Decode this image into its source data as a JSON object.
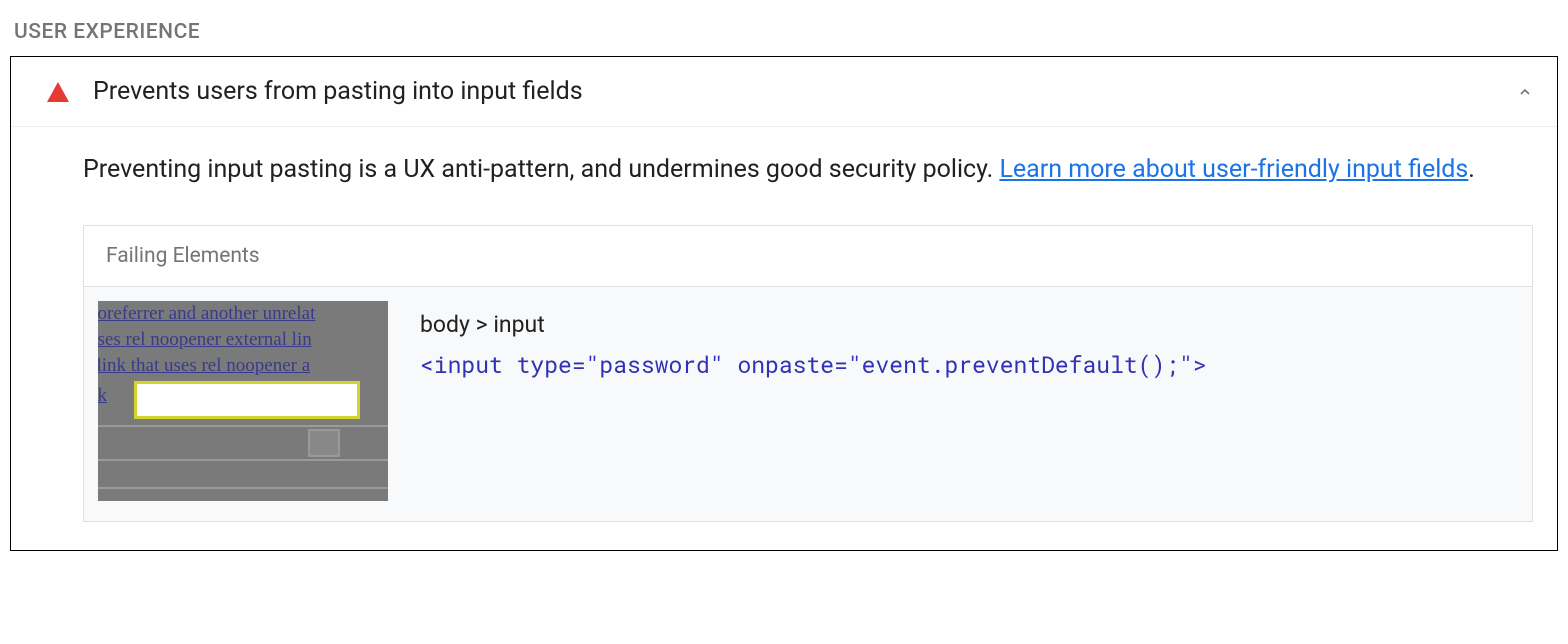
{
  "section": {
    "title": "USER EXPERIENCE"
  },
  "audit": {
    "title": "Prevents users from pasting into input fields",
    "description_text": "Preventing input pasting is a UX anti-pattern, and undermines good security policy. ",
    "learn_more_text": "Learn more about user-friendly input fields",
    "description_period": "."
  },
  "failing": {
    "header": "Failing Elements",
    "selector": "body > input",
    "snippet": "<input type=\"password\" onpaste=\"event.preventDefault();\">",
    "thumb": {
      "line1": " noreferrer and another unrelat",
      "line2": "t uses rel noopener external lin",
      "line3": "al link that uses rel noopener a",
      "line4": " ok"
    }
  }
}
